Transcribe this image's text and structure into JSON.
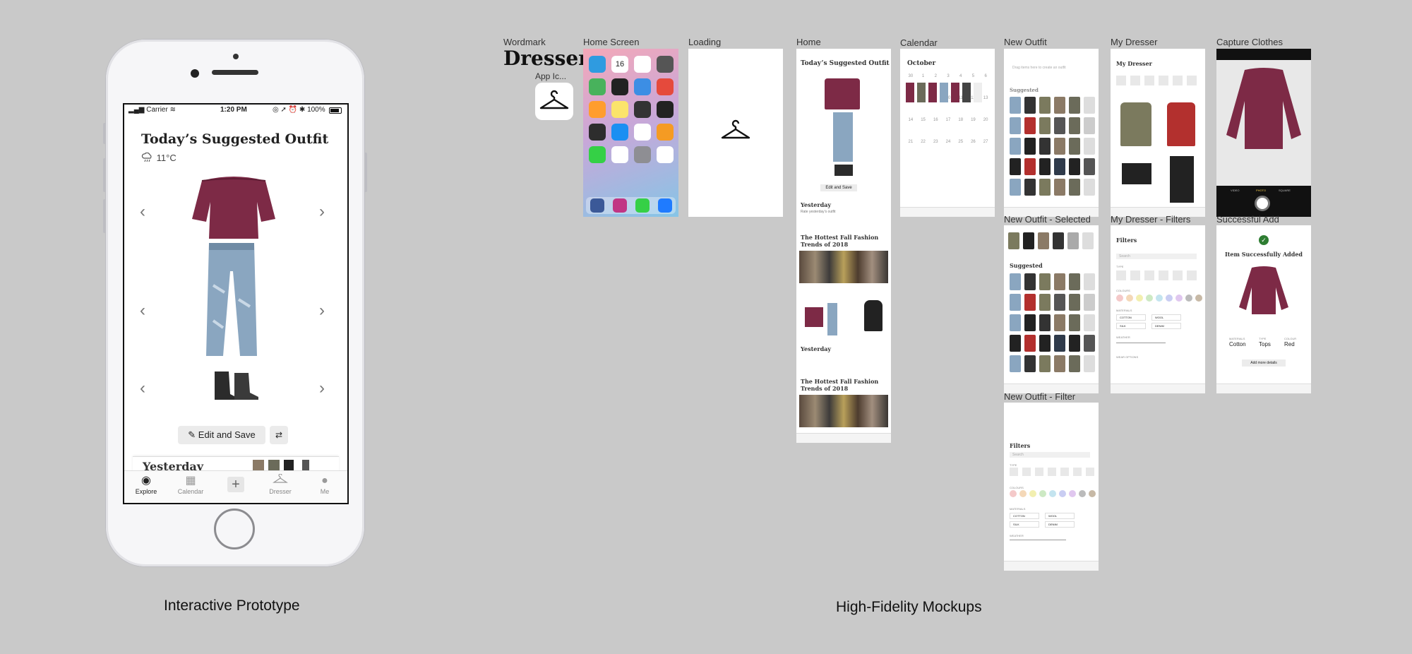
{
  "prototype": {
    "caption": "Interactive Prototype",
    "status": {
      "carrier": "Carrier",
      "time": "1:20 PM",
      "battery": "100%"
    },
    "title": "Today’s Suggested Outfit",
    "weather": "11°C",
    "edit_label": "Edit and Save",
    "peek_title": "Yesterday",
    "tabs": [
      {
        "label": "Explore",
        "icon": "compass-icon"
      },
      {
        "label": "Calendar",
        "icon": "calendar-icon"
      },
      {
        "label": "",
        "icon": "plus-icon"
      },
      {
        "label": "Dresser",
        "icon": "hanger-icon"
      },
      {
        "label": "Me",
        "icon": "user-icon"
      }
    ]
  },
  "mockups": {
    "caption": "High-Fidelity Mockups",
    "wordmark_label": "Wordmark",
    "wordmark": "Dresser",
    "app_icon_label": "App Ic...",
    "labels": {
      "home_screen": "Home Screen",
      "loading": "Loading",
      "home": "Home",
      "calendar": "Calendar",
      "new_outfit": "New Outfit",
      "my_dresser": "My Dresser",
      "capture_clothes": "Capture Clothes",
      "new_outfit_selected": "New Outfit - Selected",
      "my_dresser_filters": "My Dresser - Filters",
      "successful_add": "Successful Add",
      "new_outfit_filter": "New Outfit - Filter"
    },
    "home": {
      "title": "Today’s Suggested Outfit",
      "edit": "Edit and Save",
      "yesterday": "Yesterday",
      "yesterday_sub": "Rate yesterday’s outfit",
      "article": "The Hottest Fall Fashion Trends of 2018",
      "article2": "The Hottest Fall Fashion Trends of 2018"
    },
    "calendar": {
      "month": "October",
      "days": [
        "30",
        "1",
        "2",
        "3",
        "4",
        "5",
        "6",
        "7",
        "8",
        "9",
        "10",
        "11",
        "12",
        "13",
        "14",
        "15",
        "16",
        "17",
        "18",
        "19",
        "20",
        "21",
        "22",
        "23",
        "24",
        "25",
        "26",
        "27"
      ]
    },
    "new_outfit": {
      "hint": "Drag items here to create an outfit",
      "suggested": "Suggested"
    },
    "my_dresser": {
      "title": "My Dresser"
    },
    "filters": {
      "title": "Filters",
      "search": "Search",
      "type": "TYPE",
      "colours": "COLOURS",
      "materials": "MATERIALS",
      "weather": "WEATHER",
      "occasions": "WEAR OPTIONS",
      "mat_items": [
        "COTTON",
        "WOOL",
        "SILK",
        "DENIM"
      ]
    },
    "new_outfit_filter": {
      "title": "Filters",
      "search": "Search",
      "type": "TYPE",
      "colours": "COLOURS",
      "materials": "MATERIALS",
      "weather": "WEATHER",
      "mat_items": [
        "COTTON",
        "WOOL",
        "SILK",
        "DENIM"
      ]
    },
    "successful_add": {
      "title": "Item Successfully Added",
      "material": "Cotton",
      "type": "Tops",
      "colour": "Red",
      "mat_label": "MATERIALS",
      "type_label": "TYPE",
      "colour_label": "COLOUR",
      "add_more": "Add more details"
    },
    "capture": {
      "modes": [
        "VIDEO",
        "PHOTO",
        "SQUARE"
      ]
    },
    "home_screen": {
      "date": "16"
    },
    "colors": {
      "maroon": "#7d2a46",
      "denim": "#8aa6c0",
      "dark": "#2b2b2b",
      "olive": "#7b7a5e",
      "red": "#b3302e",
      "background": "#c9c9c9"
    }
  }
}
